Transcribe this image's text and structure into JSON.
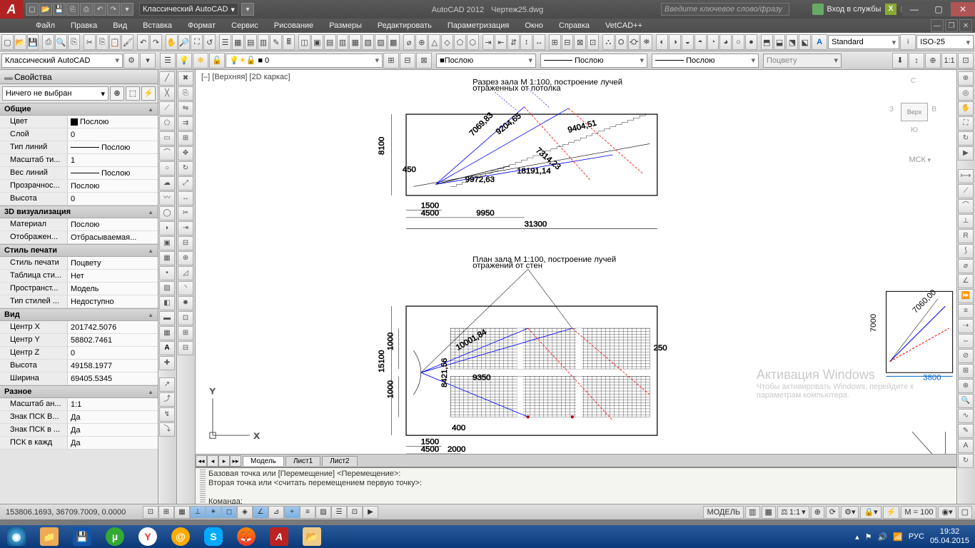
{
  "titlebar": {
    "workspace": "Классический AutoCAD",
    "app": "AutoCAD 2012",
    "file": "Чертеж25.dwg",
    "search_placeholder": "Введите ключевое слово/фразу",
    "signin": "Вход в службы"
  },
  "menubar": [
    "Файл",
    "Правка",
    "Вид",
    "Вставка",
    "Формат",
    "Сервис",
    "Рисование",
    "Размеры",
    "Редактировать",
    "Параметризация",
    "Окно",
    "Справка",
    "VetCAD++"
  ],
  "toolbar1": {
    "style": "Standard",
    "dimstyle": "ISO-25"
  },
  "toolbar2": {
    "workspace_dd": "Классический AutoCAD",
    "layer": "0",
    "color": "Послою",
    "linetype": "Послою",
    "lineweight": "Послою",
    "plotstyle": "Поцвету"
  },
  "properties": {
    "title": "Свойства",
    "selection": "Ничего не выбран",
    "groups": [
      {
        "header": "Общие",
        "rows": [
          {
            "k": "Цвет",
            "v": "Послою",
            "swatch": true
          },
          {
            "k": "Слой",
            "v": "0"
          },
          {
            "k": "Тип линий",
            "v": "Послою",
            "line": true
          },
          {
            "k": "Масштаб ти...",
            "v": "1"
          },
          {
            "k": "Вес линий",
            "v": "Послою",
            "line": true
          },
          {
            "k": "Прозрачнос...",
            "v": "Послою"
          },
          {
            "k": "Высота",
            "v": "0"
          }
        ]
      },
      {
        "header": "3D визуализация",
        "rows": [
          {
            "k": "Материал",
            "v": "Послою"
          },
          {
            "k": "Отображен...",
            "v": "Отбрасываемая..."
          }
        ]
      },
      {
        "header": "Стиль печати",
        "rows": [
          {
            "k": "Стиль печати",
            "v": "Поцвету"
          },
          {
            "k": "Таблица сти...",
            "v": "Нет"
          },
          {
            "k": "Пространст...",
            "v": "Модель"
          },
          {
            "k": "Тип стилей ...",
            "v": "Недоступно"
          }
        ]
      },
      {
        "header": "Вид",
        "rows": [
          {
            "k": "Центр X",
            "v": "201742.5076"
          },
          {
            "k": "Центр Y",
            "v": "58802.7461"
          },
          {
            "k": "Центр Z",
            "v": "0"
          },
          {
            "k": "Высота",
            "v": "49158.1977"
          },
          {
            "k": "Ширина",
            "v": "69405.5345"
          }
        ]
      },
      {
        "header": "Разное",
        "rows": [
          {
            "k": "Масштаб ан...",
            "v": "1:1"
          },
          {
            "k": "Знак ПСК В...",
            "v": "Да"
          },
          {
            "k": "Знак ПСК в ...",
            "v": "Да"
          },
          {
            "k": "ПСК в кажд",
            "v": "Да"
          }
        ]
      }
    ]
  },
  "drawing": {
    "view_label": "[–] [Верхняя] [2D каркас]",
    "text1": "Разрез зала М 1:100, построение лучей",
    "text1b": "отраженных от потолка",
    "text2": "План зала М 1:100, построение лучей",
    "text2b": "отражений от стен",
    "dims": {
      "d1": "8100",
      "d2": "4500",
      "d3": "9950",
      "d4": "31300",
      "d5": "1500",
      "d6": "15100",
      "d7": "1000",
      "d8": "2000",
      "d9": "400",
      "d10": "9972,63",
      "d11": "7069,83",
      "d12": "9204,65",
      "d13": "9404,51",
      "d14": "18191,14",
      "d15": "7314,23",
      "d16": "7000",
      "d17": "3800",
      "d18": "7060,00",
      "d19": "9350",
      "d20": "10001,84",
      "d21": "8421,56",
      "d22": "250"
    },
    "viewcube": {
      "face": "Верх",
      "n": "С",
      "s": "Ю",
      "w": "З",
      "e": "В",
      "ucs": "МСК"
    }
  },
  "modeltabs": {
    "nav": [
      "◂◂",
      "◂",
      "▸",
      "▸▸"
    ],
    "tabs": [
      "Модель",
      "Лист1",
      "Лист2"
    ]
  },
  "cmdline": {
    "l1": "Базовая точка или [Перемещение] <Перемещение>:",
    "l2": "Вторая точка или <считать перемещением первую точку>:",
    "l3": "Команда:"
  },
  "statusbar": {
    "coords": "153806.1693, 36709.7009, 0.0000",
    "model_btn": "МОДЕЛЬ",
    "anno": "1:1",
    "mscale": "М = 100"
  },
  "watermark": {
    "l1": "Активация Windows",
    "l2": "Чтобы активировать Windows, перейдите к",
    "l3": "параметрам компьютера."
  },
  "taskbar": {
    "lang": "РУС",
    "time": "19:32",
    "date": "05.04.2015"
  }
}
